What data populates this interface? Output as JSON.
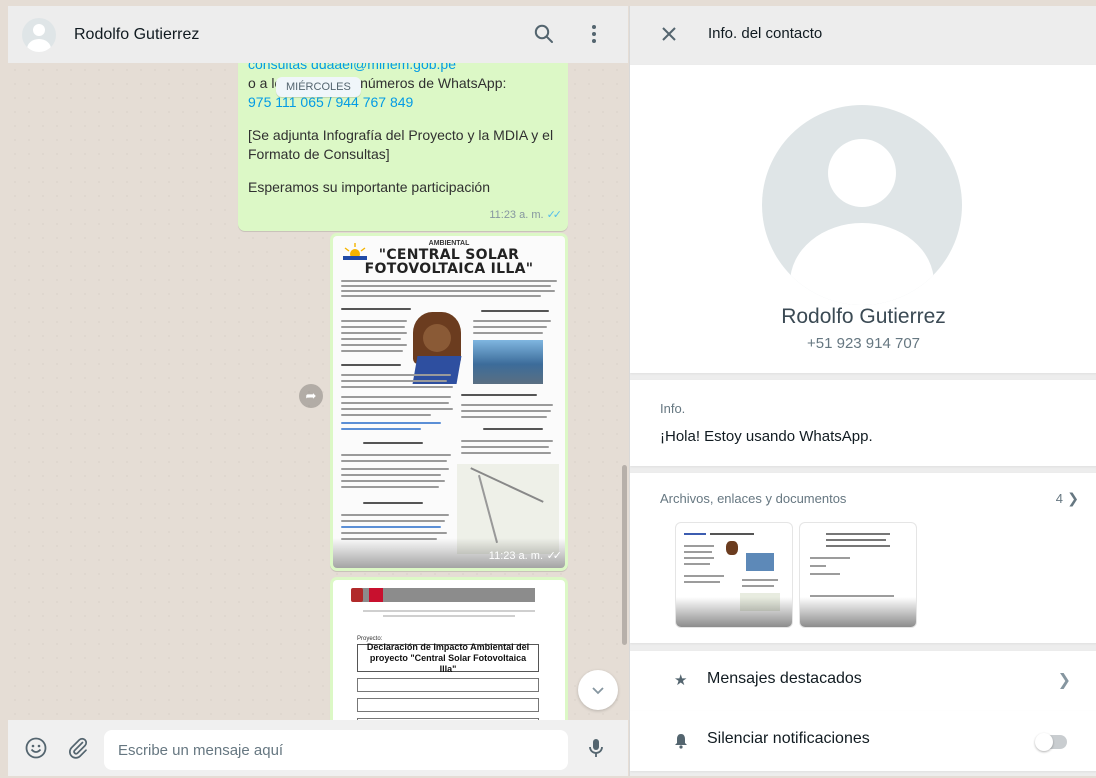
{
  "chat": {
    "contact_name": "Rodolfo Gutierrez",
    "day_separator": "MIÉRCOLES",
    "text_message": {
      "lines": [
        "consultas ddaael@minem.gob.pe",
        "o a los siguientes números de WhatsApp:",
        "975 111 065 / 944 767 849",
        "[Se adjunta Infografía del Proyecto y la MDIA y el",
        "Formato de Consultas]",
        "Esperamos su importante participación"
      ],
      "time": "11:23 a. m."
    },
    "image_message": {
      "small_heading": "AMBIENTAL",
      "title_line1": "\"CENTRAL SOLAR",
      "title_line2": "FOTOVOLTAICA ILLA\"",
      "time": "11:23 a. m."
    },
    "document_message": {
      "label": "Proyecto:",
      "box_title": "Declaración de Impacto Ambiental del proyecto \"Central Solar Fotovoltaica Illa\""
    },
    "composer_placeholder": "Escribe un mensaje aquí"
  },
  "info": {
    "header_title": "Info. del contacto",
    "name": "Rodolfo Gutierrez",
    "phone": "+51 923 914 707",
    "about_label": "Info.",
    "about_text": "¡Hola! Estoy usando WhatsApp.",
    "media_label": "Archivos, enlaces y documentos",
    "media_count": "4",
    "starred_label": "Mensajes destacados",
    "mute_label": "Silenciar notificaciones",
    "mute_enabled": false
  },
  "colors": {
    "outgoing_bubble": "#dcf8c6",
    "chat_background": "#e5ddd5",
    "panel_header": "#ededed",
    "read_ticks": "#53bdeb"
  }
}
